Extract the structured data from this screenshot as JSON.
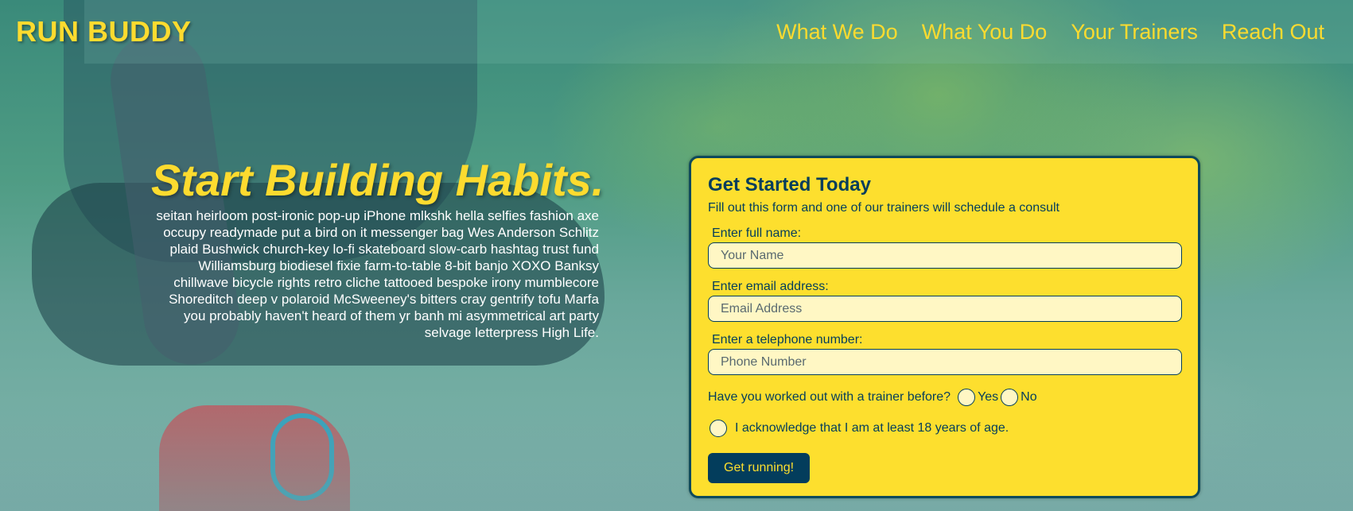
{
  "header": {
    "logo": "RUN BUDDY",
    "nav": [
      "What We Do",
      "What You Do",
      "Your Trainers",
      "Reach Out"
    ]
  },
  "hero": {
    "title": "Start Building Habits.",
    "text": "seitan heirloom post-ironic pop-up iPhone mlkshk hella selfies fashion axe occupy readymade put a bird on it messenger bag Wes Anderson Schlitz plaid Bushwick church-key lo-fi skateboard slow-carb hashtag trust fund Williamsburg biodiesel fixie farm-to-table 8-bit banjo XOXO Banksy chillwave bicycle rights retro cliche tattooed bespoke irony mumblecore Shoreditch deep v polaroid McSweeney's bitters cray gentrify tofu Marfa you probably haven't heard of them yr banh mi asymmetrical art party selvage letterpress High Life."
  },
  "form": {
    "title": "Get Started Today",
    "subtitle": "Fill out this form and one of our trainers will schedule a consult",
    "name_label": "Enter full name:",
    "name_placeholder": "Your Name",
    "email_label": "Enter email address:",
    "email_placeholder": "Email Address",
    "phone_label": "Enter a telephone number:",
    "phone_placeholder": "Phone Number",
    "trainer_question": "Have you worked out with a trainer before?",
    "yes_label": "Yes",
    "no_label": "No",
    "ack_label": "I acknowledge that I am at least 18 years of age.",
    "submit_label": "Get running!"
  },
  "colors": {
    "accent_yellow": "#fddb2f",
    "navy": "#033d5c",
    "input_bg": "#fff7c4"
  }
}
